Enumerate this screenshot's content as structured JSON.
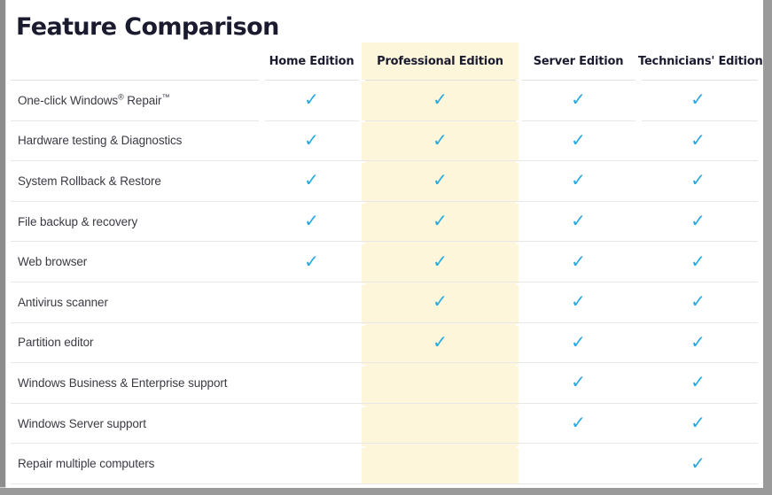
{
  "page": {
    "title": "Feature Comparison"
  },
  "table": {
    "columns": [
      {
        "key": "feature",
        "label": "",
        "highlighted": false
      },
      {
        "key": "home",
        "label": "Home Edition",
        "highlighted": false
      },
      {
        "key": "pro",
        "label": "Professional Edition",
        "highlighted": true
      },
      {
        "key": "server",
        "label": "Server Edition",
        "highlighted": false
      },
      {
        "key": "technician",
        "label": "Technicians' Edition",
        "highlighted": false
      }
    ],
    "check_glyph": "✓",
    "check_color": "#26a9e0",
    "highlight_color": "#fdf6da",
    "rows": [
      {
        "feature": "One-click Windows® Repair™",
        "feature_parts": {
          "pre": "One-click Windows",
          "sup1": "®",
          "mid": " Repair",
          "sup2": "™"
        },
        "home": true,
        "pro": true,
        "server": true,
        "technician": true
      },
      {
        "feature": "Hardware testing & Diagnostics",
        "home": true,
        "pro": true,
        "server": true,
        "technician": true
      },
      {
        "feature": "System Rollback & Restore",
        "home": true,
        "pro": true,
        "server": true,
        "technician": true
      },
      {
        "feature": "File backup & recovery",
        "home": true,
        "pro": true,
        "server": true,
        "technician": true
      },
      {
        "feature": "Web browser",
        "home": true,
        "pro": true,
        "server": true,
        "technician": true
      },
      {
        "feature": "Antivirus scanner",
        "home": false,
        "pro": true,
        "server": true,
        "technician": true
      },
      {
        "feature": "Partition editor",
        "home": false,
        "pro": true,
        "server": true,
        "technician": true
      },
      {
        "feature": "Windows Business & Enterprise support",
        "home": false,
        "pro": false,
        "server": true,
        "technician": true
      },
      {
        "feature": "Windows Server support",
        "home": false,
        "pro": false,
        "server": true,
        "technician": true
      },
      {
        "feature": "Repair multiple computers",
        "home": false,
        "pro": false,
        "server": false,
        "technician": true
      }
    ]
  }
}
